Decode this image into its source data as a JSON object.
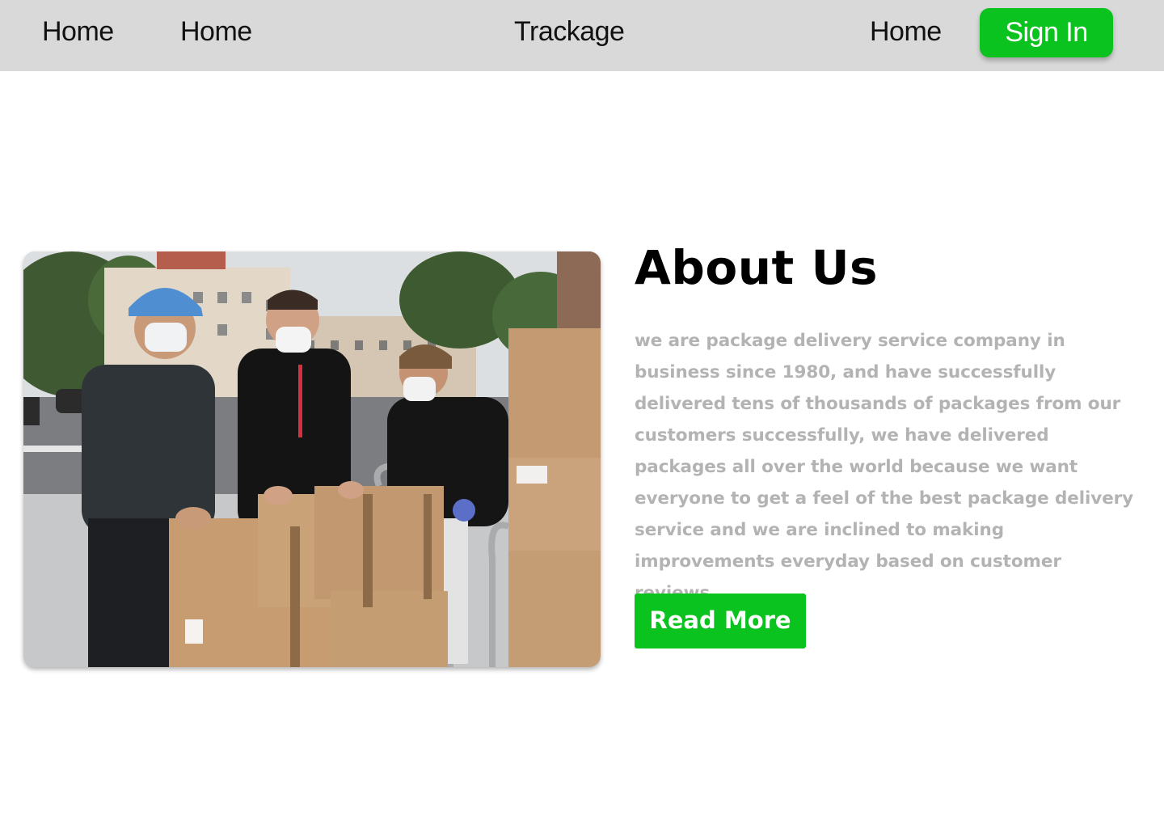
{
  "nav": {
    "links": [
      "Home",
      "Home",
      "Home"
    ],
    "brand": "Trackage",
    "signin_label": "Sign In"
  },
  "about": {
    "title": "About Us",
    "body": "we are package delivery service company in business since 1980, and have successfully delivered tens of thousands of packages from our customers successfully, we have delivered packages all over the world because we want everyone to get a feel of the best package delivery service and we are inclined to making improvements everyday based on customer reviews",
    "read_more_label": "Read More"
  },
  "colors": {
    "accent": "#0ac31e",
    "nav_bg": "#d9d9d9",
    "body_text": "#b3b3b3"
  }
}
